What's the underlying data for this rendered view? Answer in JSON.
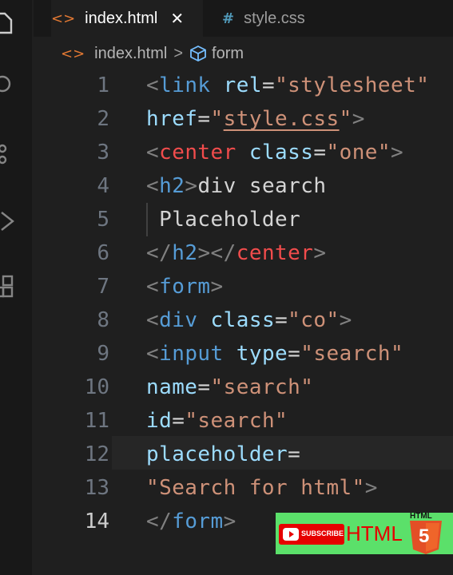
{
  "tabs": [
    {
      "icon": "<>",
      "label": "index.html",
      "close": "✕"
    },
    {
      "icon": "#",
      "label": "style.css"
    }
  ],
  "breadcrumb": {
    "file": "index.html",
    "separator": ">",
    "symbol": "form"
  },
  "lines": [
    {
      "num": "1",
      "tokens": [
        [
          "br",
          "<"
        ],
        [
          "tag",
          "link"
        ],
        [
          "txt",
          " "
        ],
        [
          "attr",
          "rel"
        ],
        [
          "txt",
          "="
        ],
        [
          "str",
          "\"stylesheet\""
        ]
      ]
    },
    {
      "num": "2",
      "tokens": [
        [
          "attr",
          "href"
        ],
        [
          "txt",
          "="
        ],
        [
          "str",
          "\""
        ],
        [
          "strul",
          "style.css"
        ],
        [
          "str",
          "\""
        ],
        [
          "br",
          ">"
        ]
      ]
    },
    {
      "num": "3",
      "tokens": [
        [
          "br",
          "<"
        ],
        [
          "tagr",
          "center"
        ],
        [
          "txt",
          " "
        ],
        [
          "attr",
          "class"
        ],
        [
          "txt",
          "="
        ],
        [
          "str",
          "\"one\""
        ],
        [
          "br",
          ">"
        ]
      ]
    },
    {
      "num": "4",
      "tokens": [
        [
          "br",
          "<"
        ],
        [
          "tag",
          "h2"
        ],
        [
          "br",
          ">"
        ],
        [
          "txt",
          "div search"
        ]
      ]
    },
    {
      "num": "5",
      "tokens": [
        [
          "txt",
          " Placeholder"
        ]
      ]
    },
    {
      "num": "6",
      "tokens": [
        [
          "br",
          "</"
        ],
        [
          "tag",
          "h2"
        ],
        [
          "br",
          "></"
        ],
        [
          "tagr",
          "center"
        ],
        [
          "br",
          ">"
        ]
      ]
    },
    {
      "num": "7",
      "tokens": [
        [
          "br",
          "<"
        ],
        [
          "tag",
          "form"
        ],
        [
          "br",
          ">"
        ]
      ]
    },
    {
      "num": "8",
      "tokens": [
        [
          "br",
          "<"
        ],
        [
          "tag",
          "div"
        ],
        [
          "txt",
          " "
        ],
        [
          "attr",
          "class"
        ],
        [
          "txt",
          "="
        ],
        [
          "str",
          "\"co\""
        ],
        [
          "br",
          ">"
        ]
      ]
    },
    {
      "num": "9",
      "tokens": [
        [
          "br",
          "<"
        ],
        [
          "tag",
          "input"
        ],
        [
          "txt",
          " "
        ],
        [
          "attr",
          "type"
        ],
        [
          "txt",
          "="
        ],
        [
          "str",
          "\"search\""
        ]
      ]
    },
    {
      "num": "10",
      "tokens": [
        [
          "attr",
          "name"
        ],
        [
          "txt",
          "="
        ],
        [
          "str",
          "\"search\""
        ]
      ]
    },
    {
      "num": "11",
      "tokens": [
        [
          "attr",
          "id"
        ],
        [
          "txt",
          "="
        ],
        [
          "str",
          "\"search\""
        ]
      ]
    },
    {
      "num": "12",
      "tokens": [
        [
          "attr",
          "placeholder"
        ],
        [
          "txt",
          "="
        ]
      ]
    },
    {
      "num": "13",
      "tokens": [
        [
          "str",
          "\"Search for html\""
        ],
        [
          "br",
          ">"
        ]
      ]
    },
    {
      "num": "14",
      "tokens": [
        [
          "br",
          "</"
        ],
        [
          "tag",
          "form"
        ],
        [
          "br",
          ">"
        ]
      ]
    }
  ],
  "current_line": 14,
  "badge": {
    "subscribe": "SUBSCRIBE",
    "label": "HTML",
    "logo_text": "HTML",
    "logo_number": "5"
  },
  "colors": {
    "bracket": "#808080",
    "tag": "#569cd6",
    "tag_center": "#f14c4c",
    "attribute": "#9cdcfe",
    "string": "#ce9178",
    "text": "#d4d4d4"
  }
}
